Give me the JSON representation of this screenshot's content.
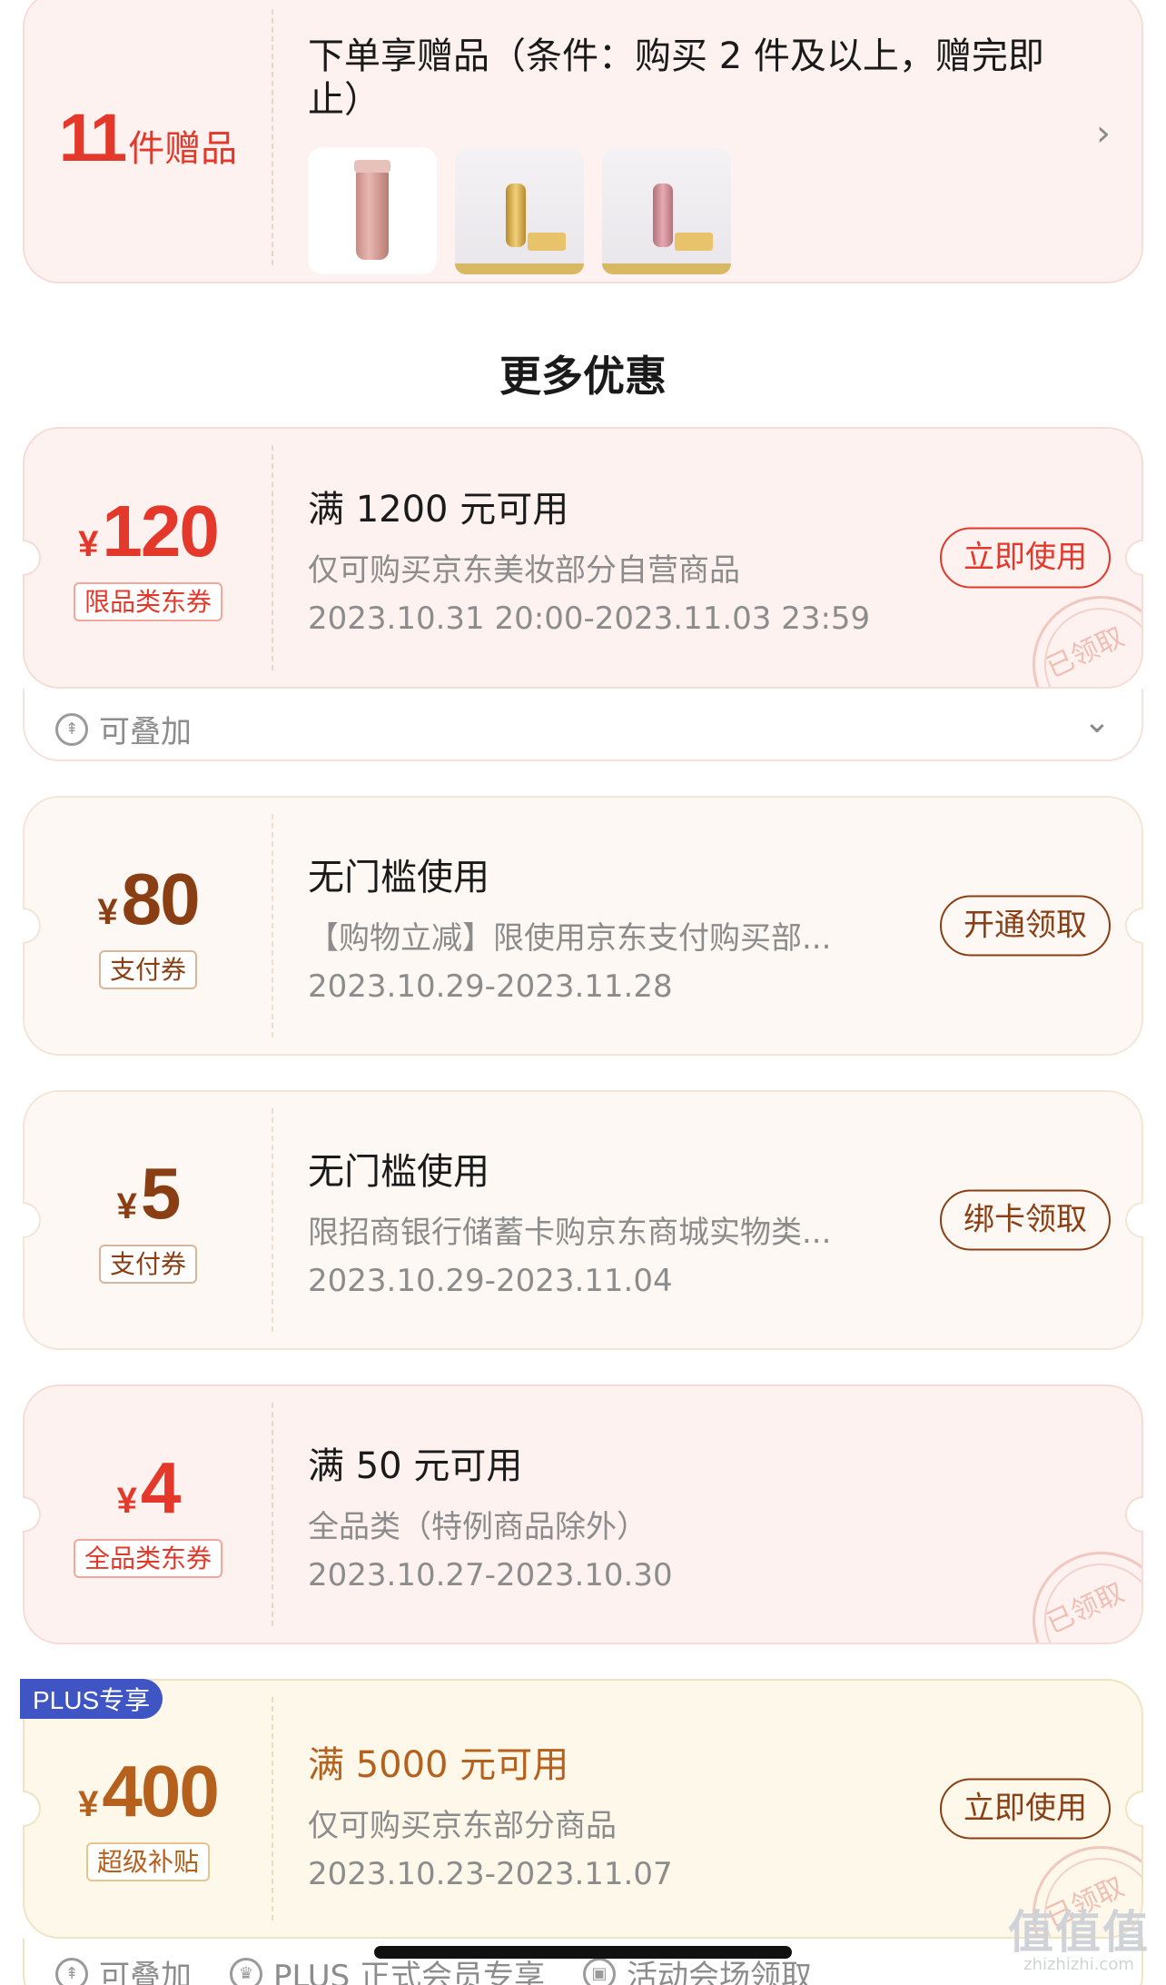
{
  "gift": {
    "count": "11",
    "count_suffix": "件赠品",
    "title": "下单享赠品（条件：购买 2 件及以上，赠完即止）"
  },
  "section_title": "更多优惠",
  "coupons": [
    {
      "currency": "¥",
      "amount": "120",
      "tag": "限品类东券",
      "title": "满 1200 元可用",
      "desc": "仅可购买京东美妆部分自营商品",
      "date": "2023.10.31 20:00-2023.11.03 23:59",
      "button": "立即使用",
      "stamp": "已领取",
      "stack_label": "可叠加"
    },
    {
      "currency": "¥",
      "amount": "80",
      "tag": "支付券",
      "title": "无门槛使用",
      "desc": "【购物立减】限使用京东支付购买部...",
      "date": "2023.10.29-2023.11.28",
      "button": "开通领取"
    },
    {
      "currency": "¥",
      "amount": "5",
      "tag": "支付券",
      "title": "无门槛使用",
      "desc": "限招商银行储蓄卡购京东商城实物类...",
      "date": "2023.10.29-2023.11.04",
      "button": "绑卡领取"
    },
    {
      "currency": "¥",
      "amount": "4",
      "tag": "全品类东券",
      "title": "满 50 元可用",
      "desc": "全品类（特例商品除外）",
      "date": "2023.10.27-2023.10.30",
      "stamp": "已领取"
    },
    {
      "badge": "PLUS专享",
      "currency": "¥",
      "amount": "400",
      "tag": "超级补贴",
      "title": "满 5000 元可用",
      "desc": "仅可购买京东部分商品",
      "date": "2023.10.23-2023.11.07",
      "button": "立即使用",
      "stamp": "已领取"
    }
  ],
  "bottom_strip": {
    "stack_label": "可叠加",
    "plus_label": "PLUS 正式会员专享",
    "venue_label": "活动会场领取"
  },
  "watermark": {
    "cn": "值值值",
    "url": "zhizhizhi.com"
  },
  "colors": {
    "red": "#e3382a",
    "brown": "#8a3e14",
    "gold": "#b5601d",
    "plus_blue": "#3f55c4"
  }
}
